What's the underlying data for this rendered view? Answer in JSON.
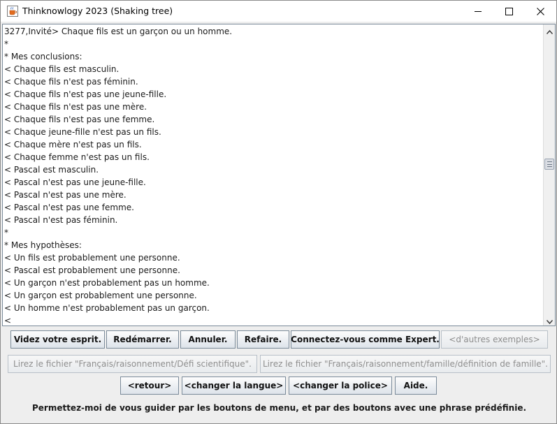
{
  "window": {
    "title": "Thinknowlogy 2023 (Shaking tree)",
    "icon": "java-cup-icon",
    "controls": [
      "minimize-icon",
      "maximize-icon",
      "close-icon"
    ]
  },
  "console": {
    "lines": [
      "3277,Invité> Chaque fils est un garçon ou un homme.",
      "*",
      "* Mes conclusions:",
      "< Chaque fils est masculin.",
      "< Chaque fils n'est pas féminin.",
      "< Chaque fils n'est pas une jeune-fille.",
      "< Chaque fils n'est pas une mère.",
      "< Chaque fils n'est pas une femme.",
      "< Chaque jeune-fille n'est pas un fils.",
      "< Chaque mère n'est pas un fils.",
      "< Chaque femme n'est pas un fils.",
      "< Pascal est masculin.",
      "< Pascal n'est pas une jeune-fille.",
      "< Pascal n'est pas une mère.",
      "< Pascal n'est pas une femme.",
      "< Pascal n'est pas féminin.",
      "*",
      "* Mes hypothèses:",
      "< Un fils est probablement une personne.",
      "< Pascal est probablement une personne.",
      "< Un garçon n'est probablement pas un homme.",
      "< Un garçon est probablement une personne.",
      "< Un homme n'est probablement pas un garçon.",
      "<"
    ],
    "scroll_position": 0.46
  },
  "buttons": {
    "row1": {
      "clear": "Videz votre esprit.",
      "restart": "Redémarrer.",
      "undo": "Annuler.",
      "redo": "Refaire.",
      "expert": "Connectez-vous comme Expert.",
      "more_examples": "<d'autres exemples>"
    },
    "row2": {
      "read_file_1": "Lirez le fichier \"Français/raisonnement/Défi scientifique\".",
      "read_file_2": "Lirez le fichier \"Français/raisonnement/famille/définition de famille\"."
    },
    "row3": {
      "back": "<retour>",
      "change_language": "<changer la langue>",
      "change_font": "<changer la police>",
      "help": "Aide."
    }
  },
  "hint": "Permettez-moi de vous guider par les boutons de menu, et par des boutons avec une phrase prédéfinie.",
  "colors": {
    "window_bg": "#eeeeee",
    "button_border": "#7a8a99",
    "disabled_text": "#8e8e8e"
  }
}
